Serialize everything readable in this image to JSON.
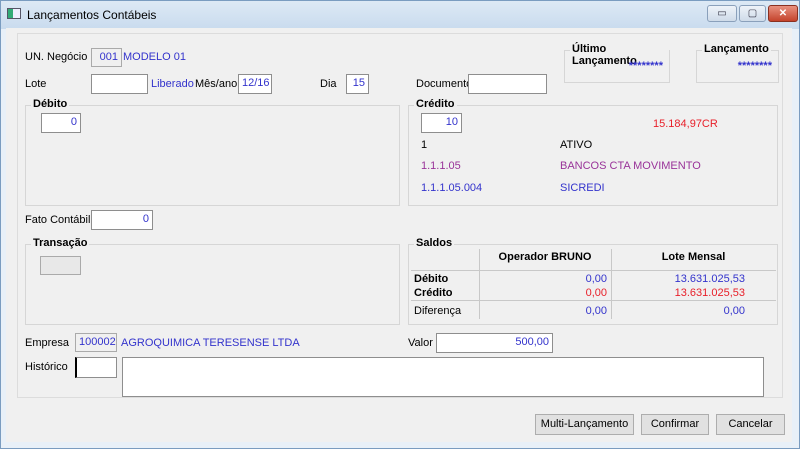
{
  "window": {
    "title": "Lançamentos Contábeis",
    "minimize": "▭",
    "maximize": "▢",
    "close": "✕"
  },
  "header": {
    "un_negocio_label": "UN. Negócio",
    "un_negocio_code": "001",
    "un_negocio_name": "MODELO 01",
    "lote_label": "Lote",
    "lote_value": "",
    "lote_status": "Liberado",
    "mes_ano_label": "Mês/ano",
    "mes_ano_value": "12/16",
    "dia_label": "Dia",
    "dia_value": "15",
    "documento_label": "Documento",
    "documento_value": "",
    "ultimo_lancamento_label": "Último Lançamento",
    "ultimo_lancamento_value": "********",
    "lancamento_label": "Lançamento",
    "lancamento_value": "********"
  },
  "debito": {
    "label": "Débito",
    "value": "0"
  },
  "credito": {
    "label": "Crédito",
    "value": "10",
    "saldo": "15.184,97CR",
    "accounts": [
      {
        "code": "1",
        "name": "ATIVO"
      },
      {
        "code": "1.1.1.05",
        "name": "BANCOS CTA MOVIMENTO"
      },
      {
        "code": "1.1.1.05.004",
        "name": "SICREDI"
      }
    ]
  },
  "fato_contabil": {
    "label": "Fato Contábil",
    "value": "0"
  },
  "transacao": {
    "label": "Transação",
    "value": ""
  },
  "saldos": {
    "label": "Saldos",
    "col1": "Operador BRUNO",
    "col2": "Lote Mensal",
    "rows": [
      {
        "label": "Débito",
        "op": "0,00",
        "lote": "13.631.025,53"
      },
      {
        "label": "Crédito",
        "op": "0,00",
        "lote": "13.631.025,53"
      },
      {
        "label": "Diferença",
        "op": "0,00",
        "lote": "0,00"
      }
    ]
  },
  "empresa": {
    "label": "Empresa",
    "code": "100002",
    "name": "AGROQUIMICA TERESENSE LTDA"
  },
  "valor": {
    "label": "Valor",
    "value": "500,00"
  },
  "historico": {
    "label": "Histórico",
    "code": "",
    "text": ""
  },
  "buttons": {
    "multi": "Multi-Lançamento",
    "confirmar": "Confirmar",
    "cancelar": "Cancelar"
  }
}
